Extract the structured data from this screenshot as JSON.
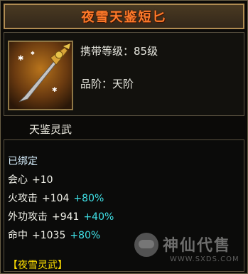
{
  "item": {
    "name": "夜雪天鉴短匕",
    "level_req": "携带等级：85级",
    "grade": "品阶：天阶",
    "subtitle": "天鉴灵武"
  },
  "stats": {
    "bound": "已绑定",
    "lines": [
      {
        "label": "会心",
        "value": "+10",
        "bonus": ""
      },
      {
        "label": "火攻击",
        "value": "+104",
        "bonus": "+80%"
      },
      {
        "label": "外功攻击",
        "value": "+941",
        "bonus": "+40%"
      },
      {
        "label": "命中",
        "value": "+1035",
        "bonus": "+80%"
      }
    ],
    "set_name": "【夜雪灵武】"
  },
  "watermark": {
    "text": "神仙代售",
    "url": "WWW.SXDS.COM"
  },
  "colors": {
    "title": "#ff7a2a",
    "bonus": "#3fe0e6",
    "set_name": "#ffe000",
    "border": "#b08c52"
  },
  "icons": [
    "dagger-item-icon",
    "watermark-mascot-icon"
  ]
}
